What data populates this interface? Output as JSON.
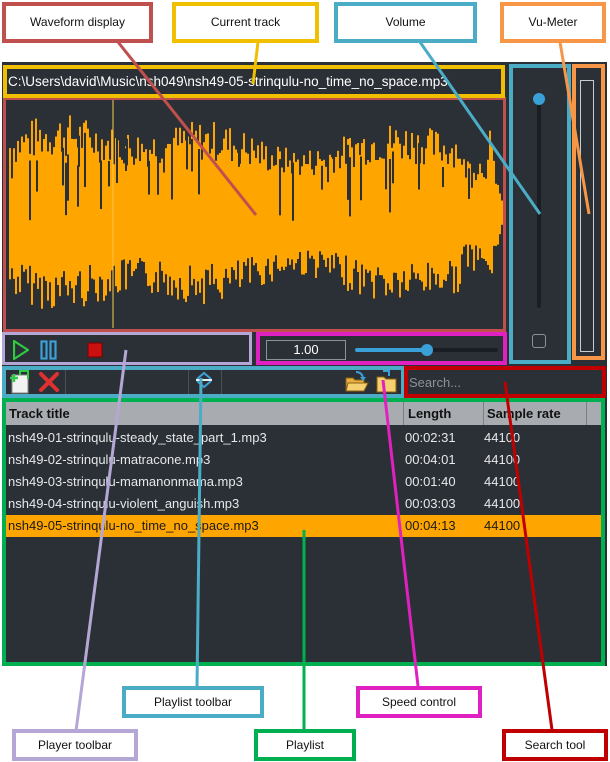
{
  "current_track": {
    "path": "C:\\Users\\david\\Music\\nsh049\\nsh49-05-strinqulu-no_time_no_space.mp3"
  },
  "speed": {
    "value": "1.00",
    "fraction": 0.5
  },
  "volume": {
    "level": 0.97
  },
  "search": {
    "placeholder": "Search..."
  },
  "playlist": {
    "columns": [
      "Track title",
      "Length",
      "Sample rate"
    ],
    "rows": [
      {
        "title": "nsh49-01-strinqulu-steady_state_part_1.mp3",
        "length": "00:02:31",
        "rate": "44100"
      },
      {
        "title": "nsh49-02-strinqulu-matracone.mp3",
        "length": "00:04:01",
        "rate": "44100"
      },
      {
        "title": "nsh49-03-strinqulu-mamanonmama.mp3",
        "length": "00:01:40",
        "rate": "44100"
      },
      {
        "title": "nsh49-04-strinqulu-violent_anguish.mp3",
        "length": "00:03:03",
        "rate": "44100"
      },
      {
        "title": "nsh49-05-strinqulu-no_time_no_space.mp3",
        "length": "00:04:13",
        "rate": "44100"
      }
    ],
    "selected_index": 4
  },
  "annotations": {
    "waveform_display": "Waveform display",
    "current_track": "Current track",
    "volume": "Volume",
    "vu_meter": "Vu-Meter",
    "player_toolbar": "Player toolbar",
    "playlist_toolbar": "Playlist toolbar",
    "playlist": "Playlist",
    "speed_control": "Speed control",
    "search_tool": "Search tool"
  },
  "icons": {
    "play": "play-icon",
    "pause": "pause-icon",
    "stop": "stop-icon",
    "add": "add-file-icon",
    "remove": "remove-icon",
    "collapse": "collapse-icon",
    "open": "open-folder-icon",
    "save": "save-icon"
  },
  "colors": {
    "app_bg": "#2b3036",
    "accent": "#ffa500",
    "slider": "#3aa0d8",
    "waveform_box": "#c0504d",
    "current_track_box": "#f0c000",
    "volume_box": "#4bacc6",
    "vu_box": "#f79646",
    "player_toolbar_box": "#b4a7d6",
    "playlist_toolbar_box": "#4bacc6",
    "playlist_box": "#00b050",
    "speed_box": "#e020c0",
    "search_box": "#c00000"
  }
}
